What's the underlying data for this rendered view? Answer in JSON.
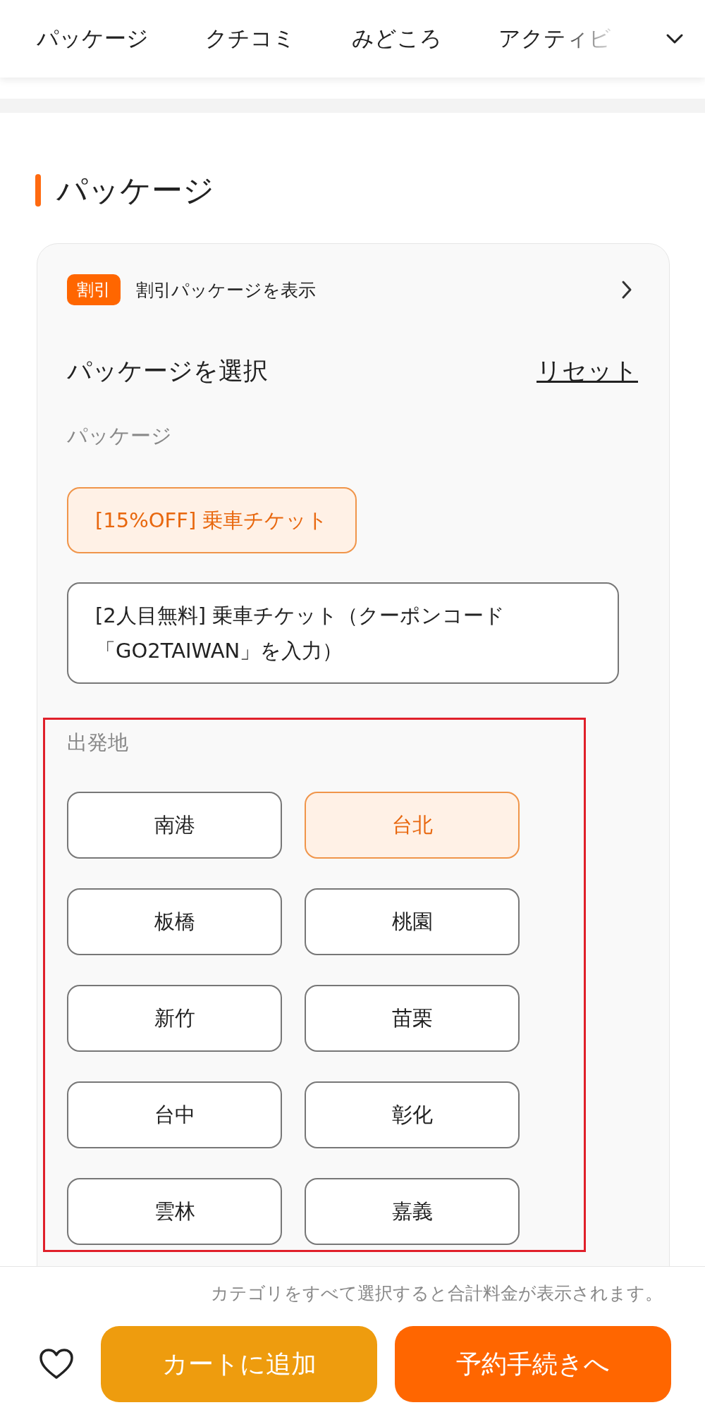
{
  "nav": {
    "tabs": [
      "パッケージ",
      "クチコミ",
      "みどころ",
      "アクティビ"
    ]
  },
  "section_title": "パッケージ",
  "discount": {
    "badge": "割引",
    "text": "割引パッケージを表示"
  },
  "selector": {
    "title": "パッケージを選択",
    "reset": "リセット"
  },
  "package_group": {
    "label": "パッケージ",
    "options": [
      {
        "label": "[15%OFF] 乗車チケット",
        "selected": true
      },
      {
        "label": "[2人目無料] 乗車チケット（クーポンコード「GO2TAIWAN」を入力）",
        "selected": false
      }
    ]
  },
  "departure": {
    "label": "出発地",
    "options": [
      {
        "label": "南港",
        "selected": false
      },
      {
        "label": "台北",
        "selected": true
      },
      {
        "label": "板橋",
        "selected": false
      },
      {
        "label": "桃園",
        "selected": false
      },
      {
        "label": "新竹",
        "selected": false
      },
      {
        "label": "苗栗",
        "selected": false
      },
      {
        "label": "台中",
        "selected": false
      },
      {
        "label": "彰化",
        "selected": false
      },
      {
        "label": "雲林",
        "selected": false
      },
      {
        "label": "嘉義",
        "selected": false
      }
    ]
  },
  "footer": {
    "hint": "カテゴリをすべて選択すると合計料金が表示されます。",
    "buttons": [
      {
        "label": "カートに追加",
        "kind": "cart"
      },
      {
        "label": "予約手続きへ",
        "kind": "book"
      }
    ]
  }
}
